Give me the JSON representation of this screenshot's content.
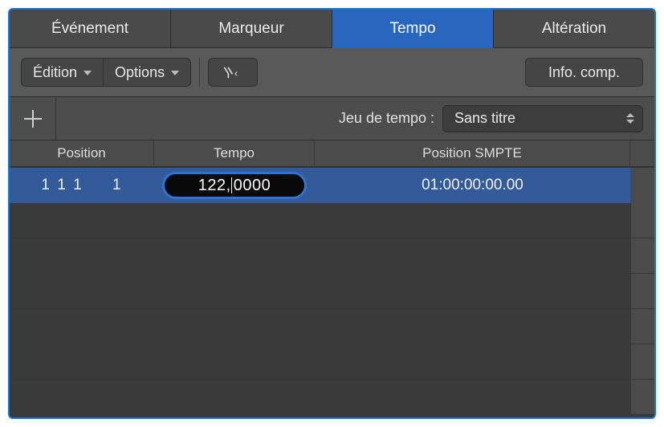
{
  "tabs": [
    {
      "label": "Événement",
      "active": false
    },
    {
      "label": "Marqueur",
      "active": false
    },
    {
      "label": "Tempo",
      "active": true
    },
    {
      "label": "Altération",
      "active": false
    }
  ],
  "toolbar": {
    "edit_label": "Édition",
    "options_label": "Options",
    "info_label": "Info. comp."
  },
  "subbar": {
    "tempo_set_label": "Jeu de tempo :",
    "tempo_set_value": "Sans titre"
  },
  "columns": {
    "position": "Position",
    "tempo": "Tempo",
    "smpte": "Position SMPTE"
  },
  "rows": [
    {
      "position": "1 1 1     1",
      "tempo_int": "122",
      "tempo_dec": "0000",
      "smpte": "01:00:00:00.00",
      "selected": true,
      "editing": true
    }
  ]
}
